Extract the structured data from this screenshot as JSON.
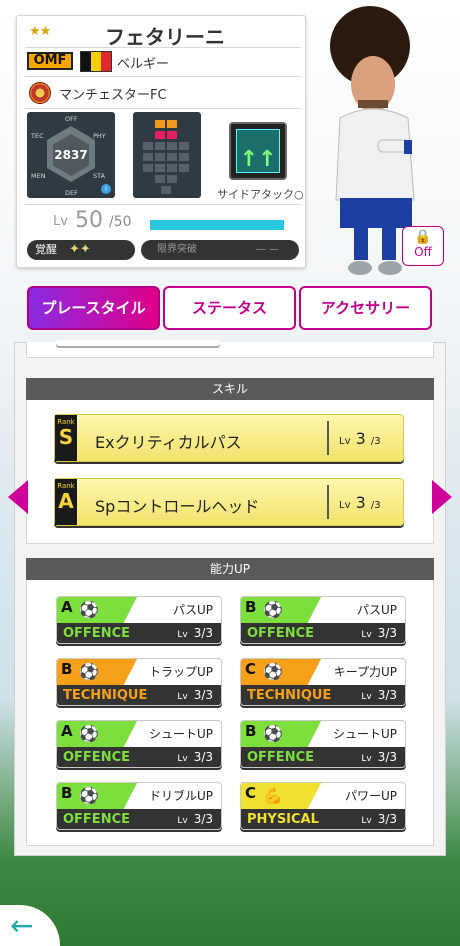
{
  "player": {
    "stars": "★★",
    "name": "フェタリーニ",
    "position": "OMF",
    "country": "ベルギー",
    "club": "マンチェスターFC",
    "radar": {
      "off": "OFF",
      "phy": "PHY",
      "sta": "STA",
      "def": "DEF",
      "men": "MEN",
      "tec": "TEC",
      "total": "2837"
    },
    "skill_label": "サイドアタック○",
    "level_prefix": "Lv",
    "level": "50",
    "level_max": "/50",
    "awakening_label": "覚醒",
    "awakening_icons": "✦✦",
    "limit_label": "限界突破",
    "limit_value": "— —"
  },
  "off_toggle": "Off",
  "tabs": [
    {
      "label": "プレースタイル",
      "active": true
    },
    {
      "label": "ステータス",
      "active": false
    },
    {
      "label": "アクセサリー",
      "active": false
    }
  ],
  "skills_section": {
    "title": "スキル",
    "items": [
      {
        "rank_tag": "Rank",
        "rank": "S",
        "name": "Exクリティカルパス",
        "lv_prefix": "Lv",
        "lv": "3",
        "lv_max": "/3"
      },
      {
        "rank_tag": "Rank",
        "rank": "A",
        "name": "Spコントロールヘッド",
        "lv_prefix": "Lv",
        "lv": "3",
        "lv_max": "/3"
      }
    ]
  },
  "ability_section": {
    "title": "能力UP",
    "items": [
      {
        "rank": "A",
        "name": "パスUP",
        "category": "OFFENCE",
        "lv": "Lv",
        "value": "3/3",
        "color": "#7ddf3c",
        "cat_color": "#7ddf3c",
        "icon": "⚽"
      },
      {
        "rank": "B",
        "name": "パスUP",
        "category": "OFFENCE",
        "lv": "Lv",
        "value": "3/3",
        "color": "#7ddf3c",
        "cat_color": "#7ddf3c",
        "icon": "⚽"
      },
      {
        "rank": "B",
        "name": "トラップUP",
        "category": "TECHNIQUE",
        "lv": "Lv",
        "value": "3/3",
        "color": "#f7a11a",
        "cat_color": "#f7a11a",
        "icon": "⚽"
      },
      {
        "rank": "C",
        "name": "キープ力UP",
        "category": "TECHNIQUE",
        "lv": "Lv",
        "value": "3/3",
        "color": "#f7a11a",
        "cat_color": "#f7a11a",
        "icon": "⚽"
      },
      {
        "rank": "A",
        "name": "シュートUP",
        "category": "OFFENCE",
        "lv": "Lv",
        "value": "3/3",
        "color": "#7ddf3c",
        "cat_color": "#7ddf3c",
        "icon": "⚽"
      },
      {
        "rank": "B",
        "name": "シュートUP",
        "category": "OFFENCE",
        "lv": "Lv",
        "value": "3/3",
        "color": "#7ddf3c",
        "cat_color": "#7ddf3c",
        "icon": "⚽"
      },
      {
        "rank": "B",
        "name": "ドリブルUP",
        "category": "OFFENCE",
        "lv": "Lv",
        "value": "3/3",
        "color": "#7ddf3c",
        "cat_color": "#7ddf3c",
        "icon": "⚽"
      },
      {
        "rank": "C",
        "name": "パワーUP",
        "category": "PHYSICAL",
        "lv": "Lv",
        "value": "3/3",
        "color": "#f0e030",
        "cat_color": "#f0e030",
        "icon": "💪"
      }
    ]
  },
  "colors": {
    "accent": "#c2008a",
    "skill_bg": "#f2e36b",
    "bar": "#29c6e0"
  }
}
